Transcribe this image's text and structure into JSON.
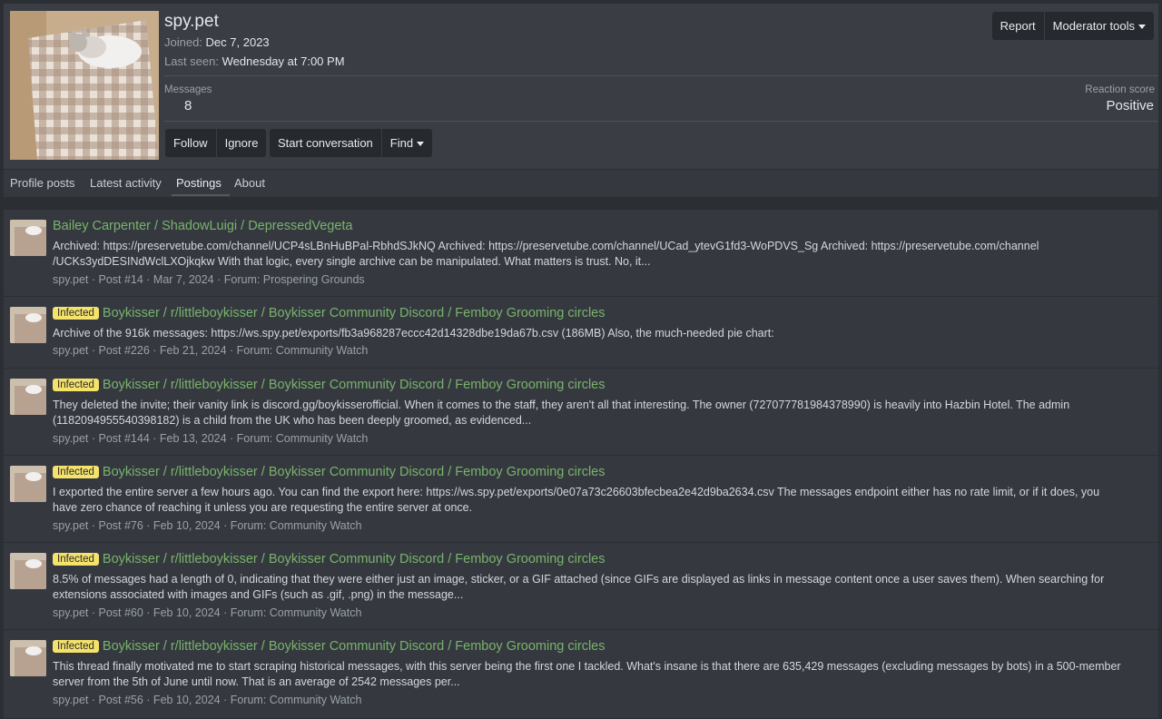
{
  "profile": {
    "username": "spy.pet",
    "joined_label": "Joined:",
    "joined_value": "Dec 7, 2023",
    "last_seen_label": "Last seen:",
    "last_seen_value": "Wednesday at 7:00 PM",
    "messages_label": "Messages",
    "messages_value": "8",
    "reaction_label": "Reaction score",
    "reaction_value": "Positive"
  },
  "header_buttons": {
    "report": "Report",
    "moderator_tools": "Moderator tools"
  },
  "action_buttons": {
    "follow": "Follow",
    "ignore": "Ignore",
    "start_conversation": "Start conversation",
    "find": "Find"
  },
  "tabs": [
    {
      "label": "Profile posts"
    },
    {
      "label": "Latest activity"
    },
    {
      "label": "Postings",
      "active": true
    },
    {
      "label": "About"
    }
  ],
  "results": [
    {
      "badge": "",
      "title": "Bailey Carpenter / ShadowLuigi / DepressedVegeta",
      "snippet_1": "Archived: https://preservetube.com/channel/UCP4sLBnHuBPal-RbhdSJkNQ Archived: https://preservetube.com/channel/UCad_ytevG1fd3-WoPDVS_Sg Archived: https://preservetube.com/channel",
      "snippet_2": "/UCKs3ydDESINdWclLXOjkqkw With that logic, every single archive can be manipulated. What matters is trust. No, it...",
      "meta": "spy.pet · Post #14 · Mar 7, 2024 · Forum: Prospering Grounds"
    },
    {
      "badge": "Infected",
      "title": "Boykisser / r/littleboykisser / Boykisser Community Discord / Femboy Grooming circles",
      "snippet_1": "Archive of the 916k messages: https://ws.spy.pet/exports/fb3a968287eccc42d14328dbe19da67b.csv (186MB) Also, the much-needed pie chart:",
      "snippet_2": "",
      "meta": "spy.pet · Post #226 · Feb 21, 2024 · Forum: Community Watch"
    },
    {
      "badge": "Infected",
      "title": "Boykisser / r/littleboykisser / Boykisser Community Discord / Femboy Grooming circles",
      "snippet_1": "They deleted the invite; their vanity link is discord.gg/boykisserofficial. When it comes to the staff, they aren't all that interesting. The owner (727077781984378990) is heavily into Hazbin Hotel. The admin",
      "snippet_2": "(1182094955540398182) is a child from the UK who has been deeply groomed, as evidenced...",
      "meta": "spy.pet · Post #144 · Feb 13, 2024 · Forum: Community Watch"
    },
    {
      "badge": "Infected",
      "title": "Boykisser / r/littleboykisser / Boykisser Community Discord / Femboy Grooming circles",
      "snippet_1": "I exported the entire server a few hours ago. You can find the export here: https://ws.spy.pet/exports/0e07a73c26603bfecbea2e42d9ba2634.csv The messages endpoint either has no rate limit, or if it does, you",
      "snippet_2": "have zero chance of reaching it unless you are requesting the entire server at once.",
      "meta": "spy.pet · Post #76 · Feb 10, 2024 · Forum: Community Watch"
    },
    {
      "badge": "Infected",
      "title": "Boykisser / r/littleboykisser / Boykisser Community Discord / Femboy Grooming circles",
      "snippet_1": "8.5% of messages had a length of 0, indicating that they were either just an image, sticker, or a GIF attached (since GIFs are displayed as links in message content once a user saves them). When searching for",
      "snippet_2": "extensions associated with images and GIFs (such as .gif, .png) in the message...",
      "meta": "spy.pet · Post #60 · Feb 10, 2024 · Forum: Community Watch"
    },
    {
      "badge": "Infected",
      "title": "Boykisser / r/littleboykisser / Boykisser Community Discord / Femboy Grooming circles",
      "snippet_1": "This thread finally motivated me to start scraping historical messages, with this server being the first one I tackled. What's insane is that there are 635,429 messages (excluding messages by bots) in a 500-member",
      "snippet_2": "server from the 5th of June until now. That is an average of 2542 messages per...",
      "meta": "spy.pet · Post #56 · Feb 10, 2024 · Forum: Community Watch"
    }
  ]
}
